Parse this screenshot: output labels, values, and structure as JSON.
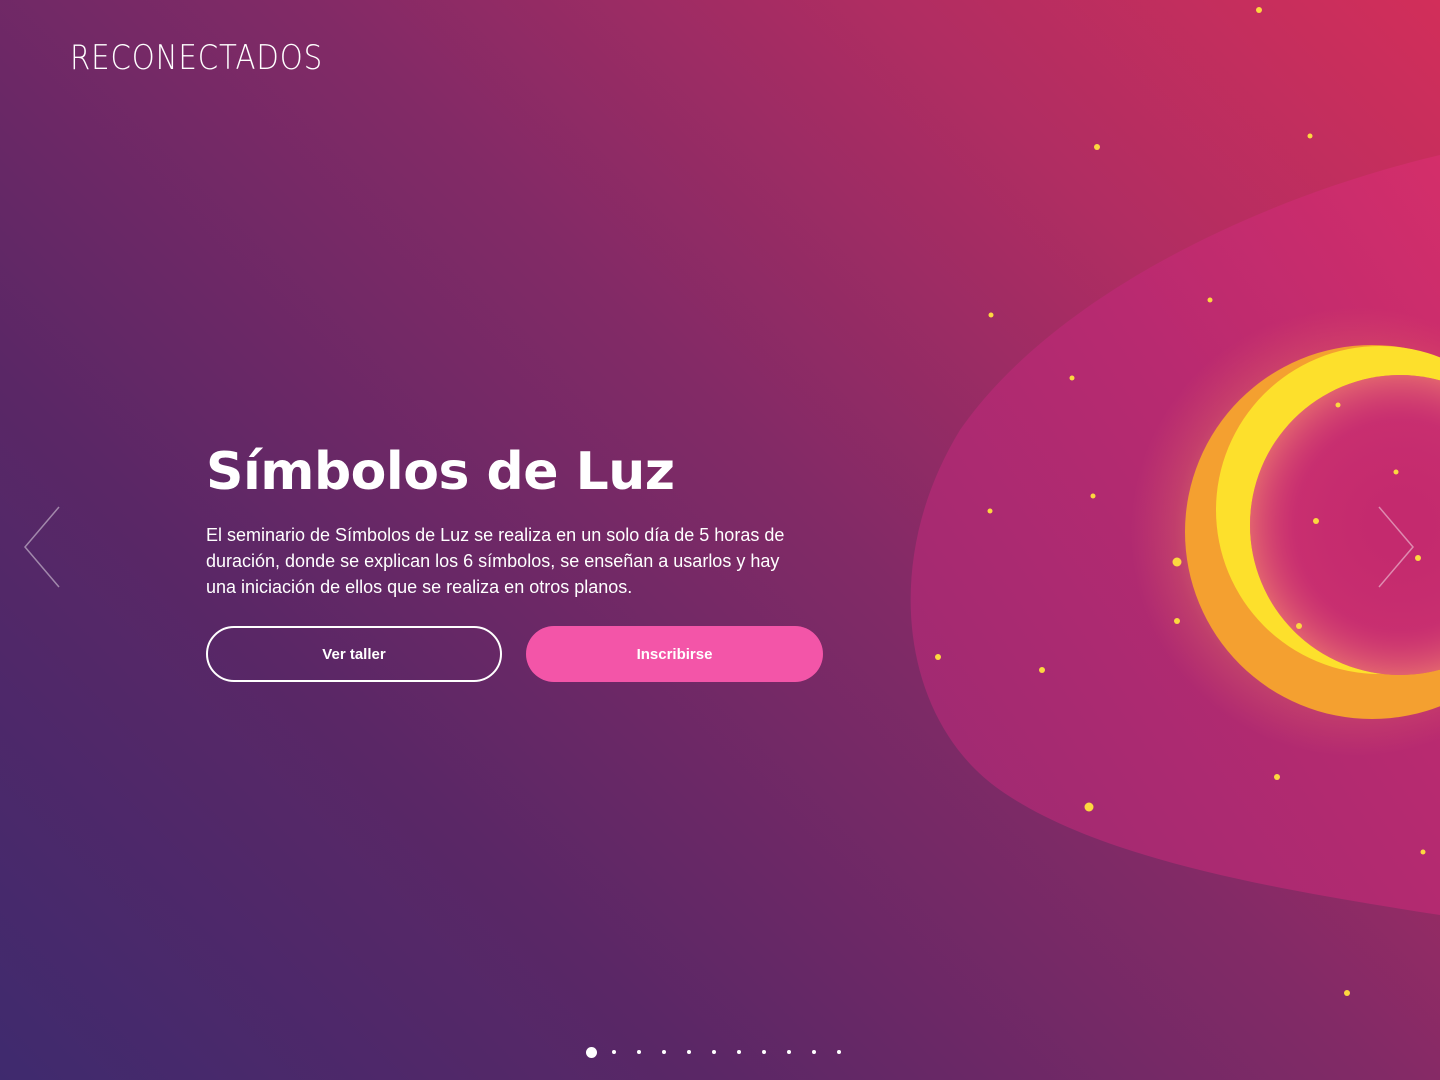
{
  "brand": {
    "logo_text": "RECONECTADOS"
  },
  "slide": {
    "title": "Símbolos de Luz",
    "description": "El seminario de Símbolos de Luz se realiza en un solo día de 5 horas de duración, donde se explican los 6 símbolos, se enseñan a usarlos y hay una iniciación de ellos que se realiza en otros planos.",
    "primary_button": "Ver taller",
    "secondary_button": "Inscribirse"
  },
  "carousel": {
    "slide_count": 11,
    "active_index": 0,
    "prev_icon": "chevron-left-icon",
    "next_icon": "chevron-right-icon"
  },
  "colors": {
    "accent_pink": "#f355a8",
    "ring_orange": "#f4a030",
    "ring_yellow": "#fde02c",
    "blob_magenta": "#c02a72",
    "star_yellow": "#fcd840"
  }
}
